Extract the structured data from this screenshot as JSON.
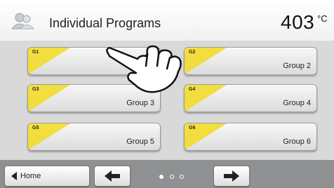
{
  "header": {
    "title": "Individual Programs",
    "temperature": "403",
    "unit": "°C",
    "icon": "user-group-icon"
  },
  "programs": [
    {
      "code": "G1",
      "label": ""
    },
    {
      "code": "G2",
      "label": "Group 2"
    },
    {
      "code": "G3",
      "label": "Group 3"
    },
    {
      "code": "G4",
      "label": "Group 4"
    },
    {
      "code": "G5",
      "label": "Group 5"
    },
    {
      "code": "G6",
      "label": "Group 6"
    }
  ],
  "footer": {
    "home_label": "Home",
    "back_icon": "arrow-left-icon",
    "forward_icon": "arrow-right-icon",
    "pages": 3,
    "current_page": 1
  },
  "overlay": {
    "icon": "pointing-hand-icon"
  },
  "colors": {
    "accent": "#f2dc2a",
    "panel": "#d9d9d9",
    "footer": "#8e9091"
  }
}
